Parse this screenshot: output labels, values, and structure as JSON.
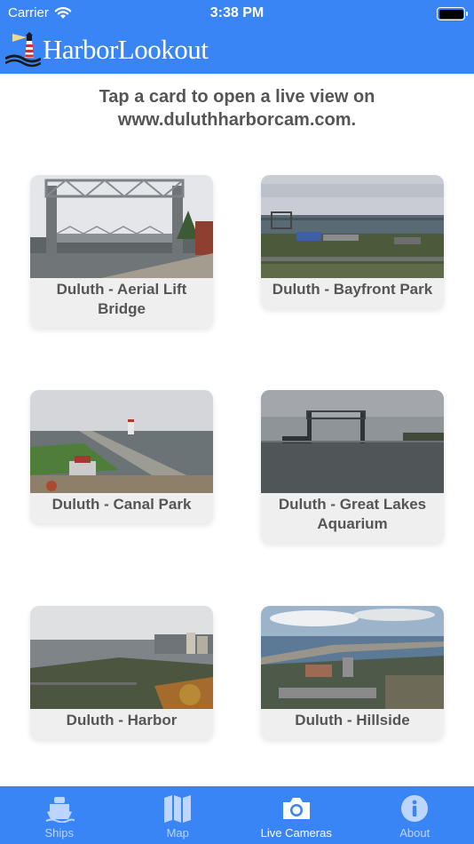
{
  "status_bar": {
    "carrier": "Carrier",
    "time": "3:38 PM"
  },
  "app": {
    "title": "HarborLookout"
  },
  "intro": {
    "line1": "Tap a card to open a live view on",
    "line2": "www.duluthharborcam.com."
  },
  "cameras": [
    {
      "label": "Duluth - Aerial Lift Bridge"
    },
    {
      "label": "Duluth - Bayfront Park"
    },
    {
      "label": "Duluth - Canal Park"
    },
    {
      "label": "Duluth - Great Lakes Aquarium"
    },
    {
      "label": "Duluth - Harbor"
    },
    {
      "label": "Duluth - Hillside"
    }
  ],
  "tabs": [
    {
      "label": "Ships",
      "icon": "ship-icon"
    },
    {
      "label": "Map",
      "icon": "map-icon"
    },
    {
      "label": "Live Cameras",
      "icon": "camera-icon",
      "active": true
    },
    {
      "label": "About",
      "icon": "info-icon"
    }
  ],
  "colors": {
    "header": "#3a85f5",
    "tab_active": "#ffffff",
    "tab_inactive": "#bcd6ff",
    "card_bg": "#efefef",
    "text_gray": "#555555"
  }
}
